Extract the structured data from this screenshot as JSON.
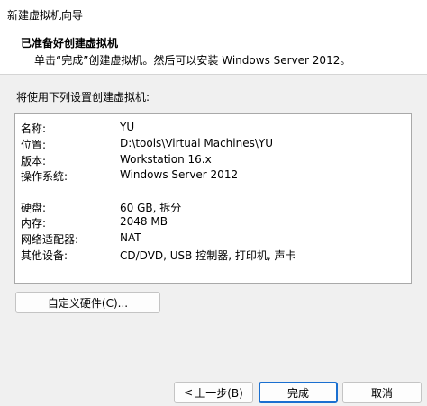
{
  "window": {
    "title": "新建虚拟机向导"
  },
  "header": {
    "heading": "已准备好创建虚拟机",
    "subtitle": "单击“完成”创建虚拟机。然后可以安装 Windows Server 2012。"
  },
  "summary_label": "将使用下列设置创建虚拟机:",
  "summary": {
    "rows": [
      {
        "key": "名称:",
        "value": "YU"
      },
      {
        "key": "位置:",
        "value": "D:\\tools\\Virtual Machines\\YU"
      },
      {
        "key": "版本:",
        "value": "Workstation 16.x"
      },
      {
        "key": "操作系统:",
        "value": "Windows Server 2012"
      },
      {
        "key": "硬盘:",
        "value": "60 GB, 拆分"
      },
      {
        "key": "内存:",
        "value": "2048 MB"
      },
      {
        "key": "网络适配器:",
        "value": "NAT"
      },
      {
        "key": "其他设备:",
        "value": "CD/DVD, USB 控制器, 打印机, 声卡"
      }
    ]
  },
  "buttons": {
    "customize": "自定义硬件(C)...",
    "back": "上一步(B)",
    "back_arrow": "<",
    "finish": "完成",
    "cancel": "取消"
  },
  "colors": {
    "default_button_border": "#1a6fd0",
    "panel_bg": "#ffffff",
    "dialog_bg": "#f0f0f0"
  }
}
